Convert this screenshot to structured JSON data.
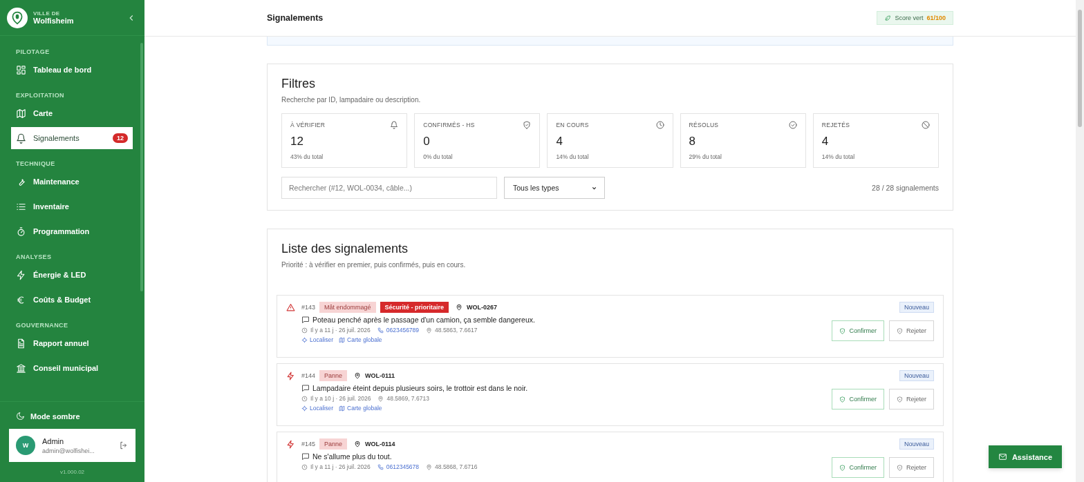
{
  "sidebar": {
    "brand": {
      "kicker": "VILLE DE",
      "name": "Wolfisheim"
    },
    "sections": [
      {
        "title": "PILOTAGE",
        "items": [
          {
            "label": "Tableau de bord",
            "selected": false
          }
        ]
      },
      {
        "title": "EXPLOITATION",
        "items": [
          {
            "label": "Carte",
            "selected": false
          },
          {
            "label": "Signalements",
            "selected": true,
            "badge": "12"
          }
        ]
      },
      {
        "title": "TECHNIQUE",
        "items": [
          {
            "label": "Maintenance",
            "selected": false
          },
          {
            "label": "Inventaire",
            "selected": false
          },
          {
            "label": "Programmation",
            "selected": false
          }
        ]
      },
      {
        "title": "ANALYSES",
        "items": [
          {
            "label": "Énergie & LED",
            "selected": false
          },
          {
            "label": "Coûts & Budget",
            "selected": false
          }
        ]
      },
      {
        "title": "GOUVERNANCE",
        "items": [
          {
            "label": "Rapport annuel",
            "selected": false
          },
          {
            "label": "Conseil municipal",
            "selected": false
          }
        ]
      }
    ],
    "dark_mode": "Mode sombre",
    "user": {
      "initial": "W",
      "name": "Admin",
      "email": "admin@wolfishei..."
    },
    "version": "v1.000.02"
  },
  "header": {
    "title": "Signalements",
    "score_label": "Score vert",
    "score_value": "61/100"
  },
  "filters": {
    "title": "Filtres",
    "subtitle": "Recherche par ID, lampadaire ou description.",
    "stats": [
      {
        "label": "À VÉRIFIER",
        "value": "12",
        "share": "43% du total"
      },
      {
        "label": "CONFIRMÉS - HS",
        "value": "0",
        "share": "0% du total"
      },
      {
        "label": "EN COURS",
        "value": "4",
        "share": "14% du total"
      },
      {
        "label": "RÉSOLUS",
        "value": "8",
        "share": "29% du total"
      },
      {
        "label": "REJETÉS",
        "value": "4",
        "share": "14% du total"
      }
    ],
    "search": {
      "placeholder": "Rechercher (#12, WOL-0034, câble...)"
    },
    "type_select": "Tous les types",
    "count": "28 / 28 signalements"
  },
  "list": {
    "title": "Liste des signalements",
    "subtitle": "Priorité : à vérifier en premier, puis confirmés, puis en cours.",
    "reports": [
      {
        "kind": "warning",
        "id": "#143",
        "tags": [
          {
            "label": "Mât endommagé",
            "kind": "light"
          },
          {
            "label": "Sécurité - prioritaire",
            "kind": "danger"
          }
        ],
        "lamp": "WOL-0267",
        "description": "Poteau penché après le passage d'un camion, ça semble dangereux.",
        "time": "Il y a 11 j · 26 juil. 2026",
        "phone": "0623456789",
        "coords": "48.5863, 7.6617",
        "links": [
          "Localiser",
          "Carte globale"
        ],
        "status": "Nouveau",
        "actions": [
          "Confirmer",
          "Rejeter"
        ]
      },
      {
        "kind": "bolt",
        "id": "#144",
        "tags": [
          {
            "label": "Panne",
            "kind": "light"
          }
        ],
        "lamp": "WOL-0111",
        "description": "Lampadaire éteint depuis plusieurs soirs, le trottoir est dans le noir.",
        "time": "Il y a 10 j · 26 juil. 2026",
        "coords": "48.5869, 7.6713",
        "links": [
          "Localiser",
          "Carte globale"
        ],
        "status": "Nouveau",
        "actions": [
          "Confirmer",
          "Rejeter"
        ]
      },
      {
        "kind": "bolt",
        "id": "#145",
        "tags": [
          {
            "label": "Panne",
            "kind": "light"
          }
        ],
        "lamp": "WOL-0114",
        "description": "Ne s'allume plus du tout.",
        "time": "Il y a 11 j · 26 juil. 2026",
        "phone": "0612345678",
        "coords": "48.5868, 7.6716",
        "status": "Nouveau",
        "actions": [
          "Confirmer",
          "Rejeter"
        ]
      }
    ]
  },
  "assistance": "Assistance"
}
